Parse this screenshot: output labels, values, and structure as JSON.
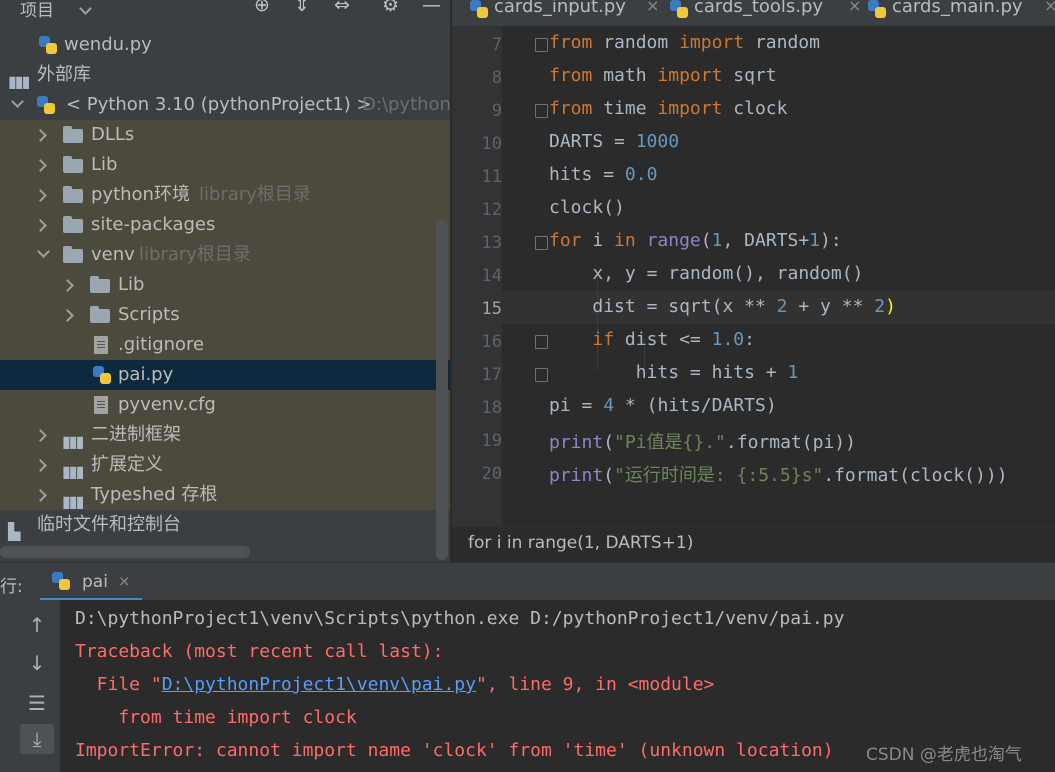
{
  "project": {
    "title": "项目",
    "tree": [
      {
        "label": "wendu.py",
        "hint": "",
        "icon": "python-file-icon"
      },
      {
        "label": "外部库",
        "hint": "",
        "icon": "library-icon"
      },
      {
        "label": "< Python 3.10 (pythonProject1) >",
        "hint": "D:\\python",
        "icon": "python-sdk-icon"
      },
      {
        "label": "DLLs",
        "hint": "",
        "icon": "folder-icon"
      },
      {
        "label": "Lib",
        "hint": "",
        "icon": "folder-icon"
      },
      {
        "label": "python环境",
        "hint": "library根目录",
        "icon": "folder-icon"
      },
      {
        "label": "site-packages",
        "hint": "",
        "icon": "folder-icon"
      },
      {
        "label": "venv",
        "hint": "library根目录",
        "icon": "folder-icon"
      },
      {
        "label": "Lib",
        "hint": "",
        "icon": "folder-icon"
      },
      {
        "label": "Scripts",
        "hint": "",
        "icon": "folder-icon"
      },
      {
        "label": ".gitignore",
        "hint": "",
        "icon": "ignore-file-icon"
      },
      {
        "label": "pai.py",
        "hint": "",
        "icon": "python-file-icon"
      },
      {
        "label": "pyvenv.cfg",
        "hint": "",
        "icon": "config-file-icon"
      },
      {
        "label": "二进制框架",
        "hint": "",
        "icon": "library-icon"
      },
      {
        "label": "扩展定义",
        "hint": "",
        "icon": "library-icon"
      },
      {
        "label": "Typeshed 存根",
        "hint": "",
        "icon": "library-icon"
      },
      {
        "label": "临时文件和控制台",
        "hint": "",
        "icon": "scratches-icon"
      }
    ]
  },
  "tabs": [
    {
      "label": "cards_input.py"
    },
    {
      "label": "cards_tools.py"
    },
    {
      "label": "cards_main.py"
    }
  ],
  "editor": {
    "line_numbers": [
      "7",
      "8",
      "9",
      "10",
      "11",
      "12",
      "13",
      "14",
      "15",
      "16",
      "17",
      "18",
      "19",
      "20"
    ],
    "current_line": "15",
    "lines": [
      "from random import random",
      "from math import sqrt",
      "from time import clock",
      "DARTS = 1000",
      "hits = 0.0",
      "clock()",
      "for i in range(1, DARTS+1):",
      "    x, y = random(), random()",
      "    dist = sqrt(x ** 2 + y ** 2)",
      "    if dist <= 1.0:",
      "        hits = hits + 1",
      "pi = 4 * (hits/DARTS)",
      "print(\"Pi值是{}.\".format(pi))",
      "print(\"运行时间是: {:5.5}s\".format(clock()))"
    ],
    "breadcrumb": "for i in range(1, DARTS+1)"
  },
  "run": {
    "label": "行:",
    "tab": "pai",
    "console": {
      "cmd": "D:\\pythonProject1\\venv\\Scripts\\python.exe D:/pythonProject1/venv/pai.py",
      "traceback": "Traceback (most recent call last):",
      "file_prefix": "  File \"",
      "file_link": "D:\\pythonProject1\\venv\\pai.py",
      "file_suffix": "\", line 9, in <module>",
      "code": "    from time import clock",
      "error": "ImportError: cannot import name 'clock' from 'time' (unknown location)"
    }
  },
  "watermark": "CSDN @老虎也淘气"
}
